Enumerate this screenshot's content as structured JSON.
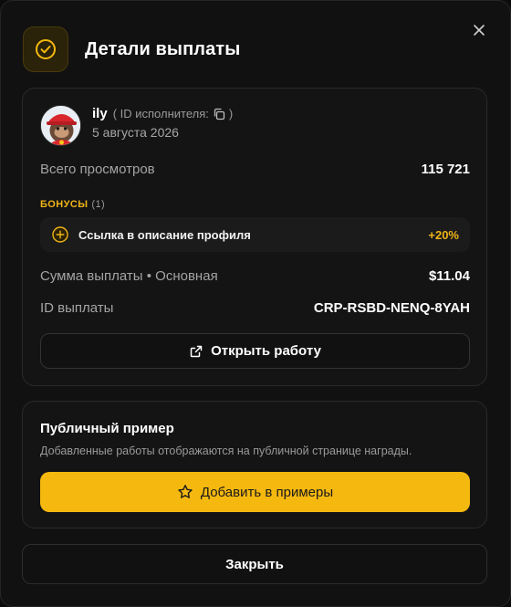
{
  "dialog": {
    "title": "Детали выплаты",
    "close_icon": "close-icon",
    "header_icon": "check-circle-icon"
  },
  "colors": {
    "accent": "#F5B80F",
    "background": "#111111",
    "card": "#141414",
    "muted_text": "#A4A4A4"
  },
  "details": {
    "user": {
      "name": "ily",
      "id_label": "( ID исполнителя:",
      "id_close": ")",
      "date": "5 августа 2026"
    },
    "total_views_label": "Всего просмотров",
    "total_views_value": "115 721",
    "bonuses_label": "БОНУСЫ",
    "bonuses_count": "(1)",
    "bonus": {
      "label": "Ссылка в описание профиля",
      "value": "+20%",
      "icon": "plus-circle-icon"
    },
    "payout_sum_label": "Сумма выплаты • Основная",
    "payout_sum_value": "$11.04",
    "payout_id_label": "ID выплаты",
    "payout_id_value": "CRP-RSBD-NENQ-8YAH",
    "open_work_label": "Открыть работу"
  },
  "public_example": {
    "title": "Публичный пример",
    "description": "Добавленные работы отображаются на публичной странице награды.",
    "add_button_label": "Добавить в примеры"
  },
  "footer": {
    "close_label": "Закрыть"
  }
}
